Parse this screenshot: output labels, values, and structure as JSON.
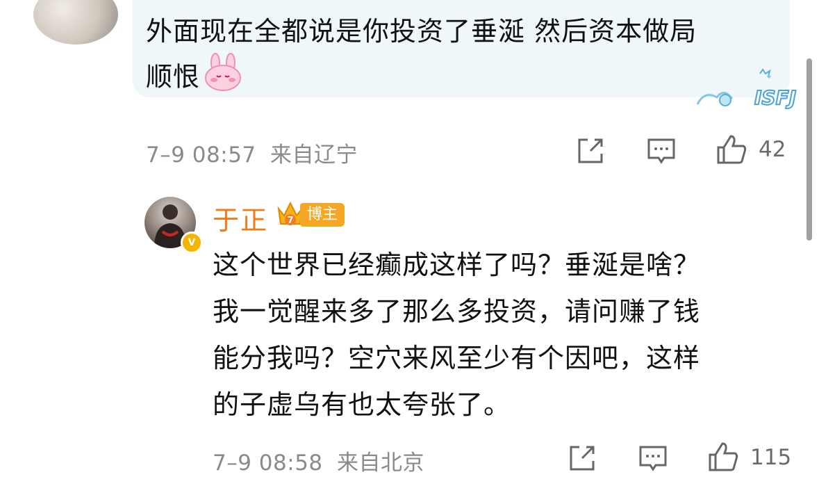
{
  "comments": [
    {
      "text_line1": "外面现在全都说是你投资了垂涎 然后资本做局",
      "text_line2": "顺恨",
      "date": "7–9 08:57",
      "location": "来自辽宁",
      "likes": "42",
      "badge_text": "ISFJ"
    },
    {
      "username": "于正",
      "role": "博主",
      "crown_level": "7",
      "verified": "V",
      "text_lines": [
        "这个世界已经癫成这样了吗？垂涎是啥？",
        "我一觉醒来多了那么多投资，请问赚了钱",
        "能分我吗？空穴来风至少有个因吧，这样",
        "的子虚乌有也太夸张了。"
      ],
      "date": "7–9 08:58",
      "location": "来自北京",
      "likes": "115"
    }
  ],
  "icons": {
    "share": "share-icon",
    "comment": "comment-icon",
    "like": "thumbs-up-icon"
  },
  "colors": {
    "bubble_bg": "#eff7fa",
    "username": "#f07c18",
    "role_tag": "#f5a623",
    "meta": "#8a8a8a"
  }
}
